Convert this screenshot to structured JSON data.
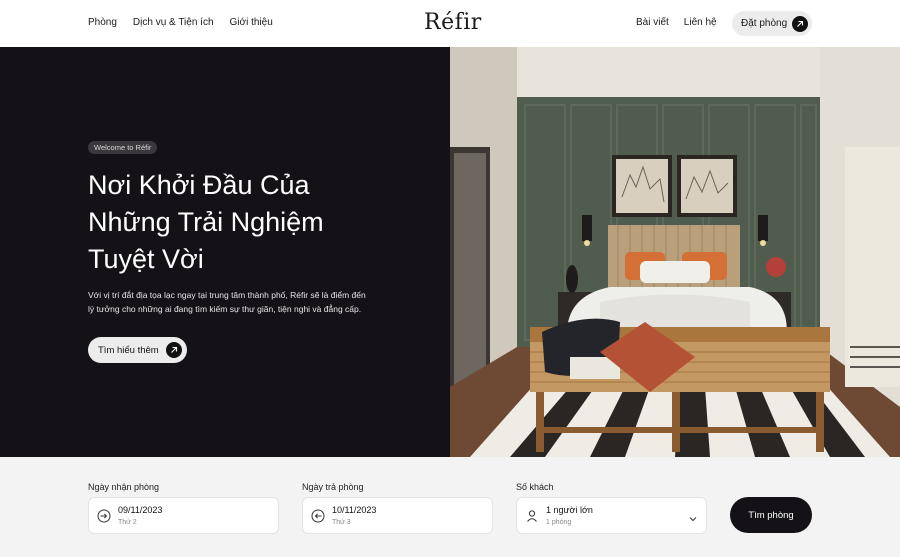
{
  "header": {
    "nav_left": [
      "Phòng",
      "Dịch vụ & Tiện ích",
      "Giới thiệu"
    ],
    "logo": "Réfir",
    "nav_right": [
      "Bài viết",
      "Liên hệ"
    ],
    "book_button": "Đặt phòng"
  },
  "hero": {
    "tag": "Welcome to Réfir",
    "title_lines": [
      "Nơi Khởi Đầu Của",
      "Những Trải Nghiệm",
      "Tuyệt Vời"
    ],
    "description_lines": [
      "Với vị trí đắt địa tọa lạc ngay tại trung tâm thành phố, Réfir sẽ là điểm đến",
      "lý tưởng cho những ai đang tìm kiếm sự thư giãn, tiện nghi và đẳng cấp."
    ],
    "cta": "Tìm hiểu thêm",
    "image_icon": "bedroom-photo"
  },
  "booking": {
    "checkin": {
      "label": "Ngày nhận phòng",
      "value": "09/11/2023",
      "sub": "Thứ 2",
      "icon": "arrow-in-icon"
    },
    "checkout": {
      "label": "Ngày trả phòng",
      "value": "10/11/2023",
      "sub": "Thứ 3",
      "icon": "arrow-out-icon"
    },
    "guests": {
      "label": "Số khách",
      "value": "1 người lớn",
      "sub": "1 phòng",
      "icon": "user-icon"
    },
    "search_button": "Tìm phòng"
  },
  "colors": {
    "dark": "#141217",
    "light_bg": "#f3f3f3",
    "accent_wall": "#4f5c4e"
  }
}
